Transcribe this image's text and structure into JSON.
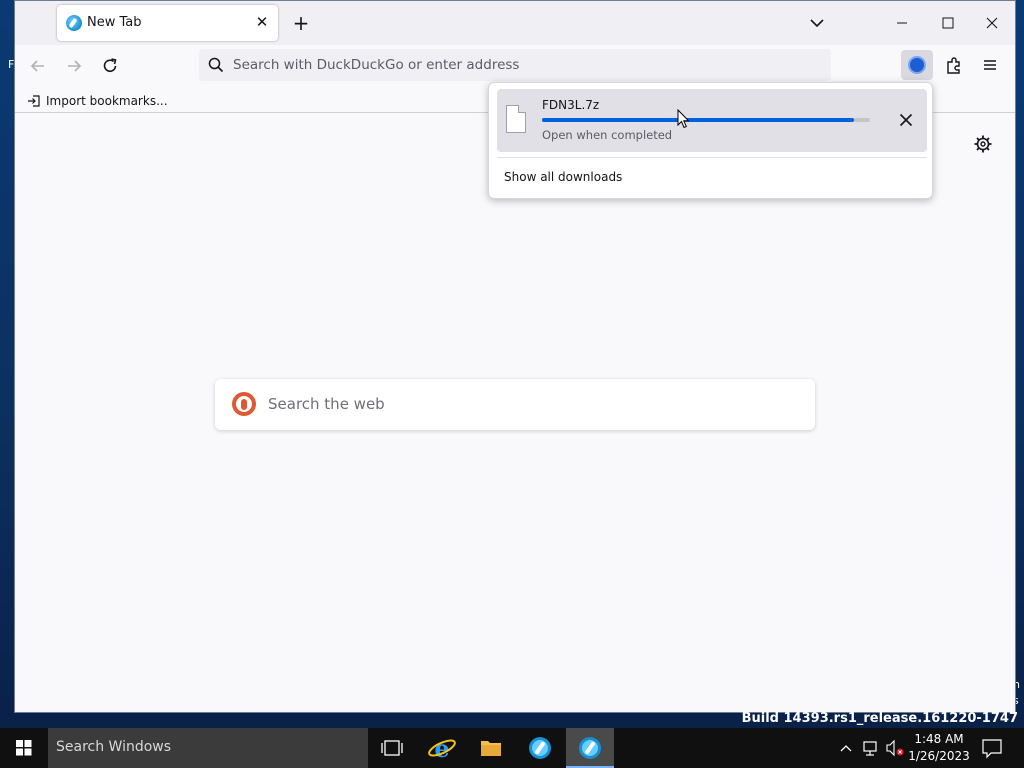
{
  "tab": {
    "title": "New Tab",
    "close_glyph": "✕"
  },
  "new_tab_glyph": "+",
  "urlbar": {
    "placeholder": "Search with DuckDuckGo or enter address"
  },
  "bookmarks": {
    "import_label": "Import bookmarks..."
  },
  "newtab": {
    "search_placeholder": "Search the web"
  },
  "downloads_panel": {
    "file_name": "FDN3L.7z",
    "status": "Open when completed",
    "progress": 0.95,
    "show_all_label": "Show all downloads"
  },
  "desktop": {
    "build_watermark": "Build 14393.rs1_release.161220-1747",
    "peek_left": "F",
    "peek_right_1": "n",
    "peek_right_2": "s"
  },
  "taskbar": {
    "search_placeholder": "Search Windows",
    "time": "1:48 AM",
    "date": "1/26/2023"
  },
  "colors": {
    "accent": "#0061e0",
    "ddg_orange": "#de5833"
  }
}
